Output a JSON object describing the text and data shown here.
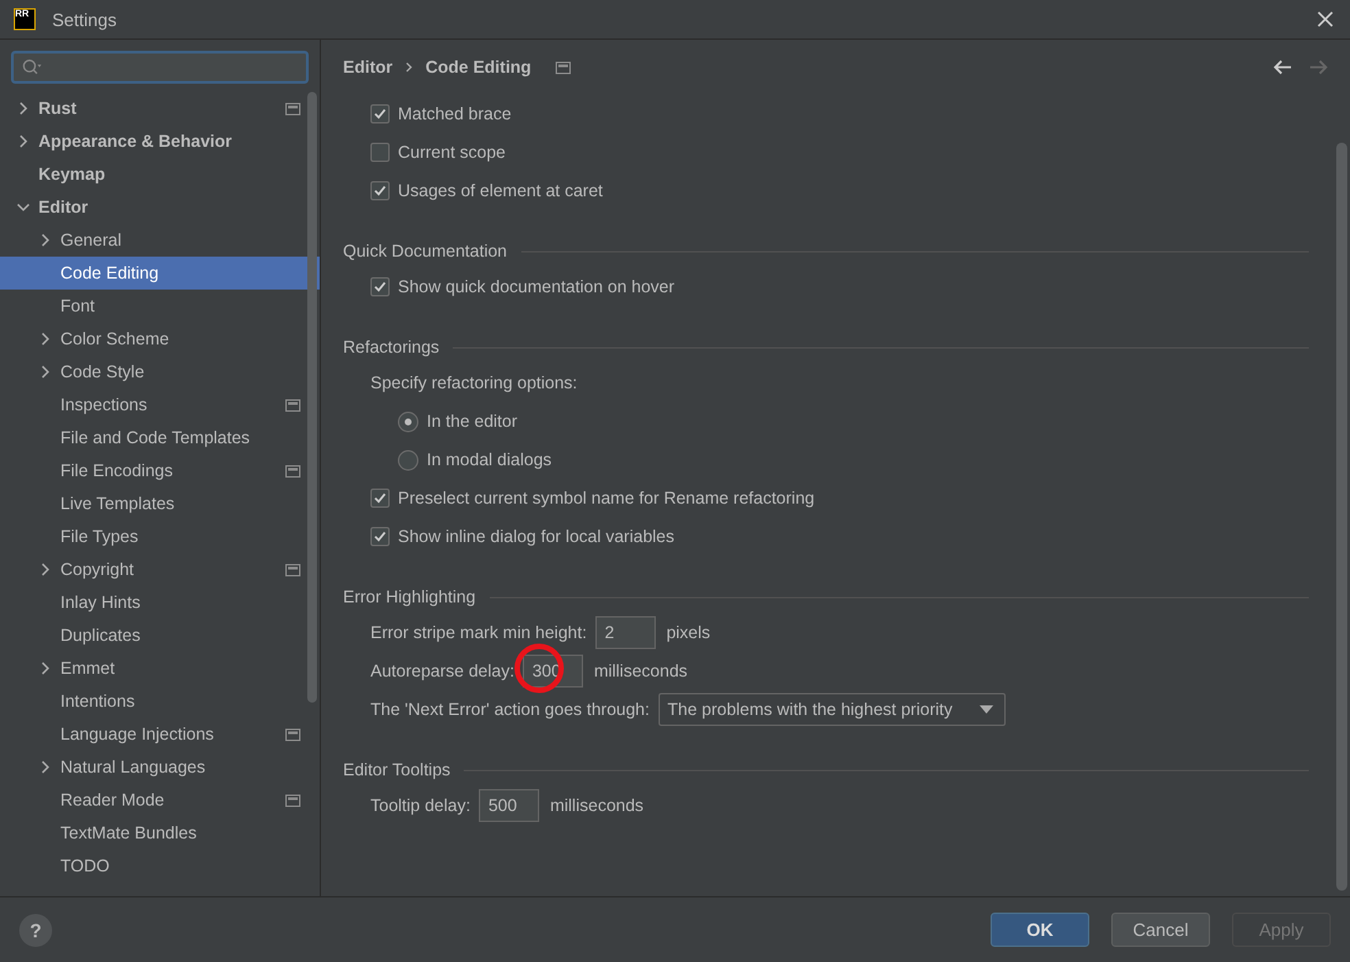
{
  "window": {
    "title": "Settings",
    "logo": "RR"
  },
  "sidebar": {
    "items": [
      {
        "label": "Rust",
        "expanded": false,
        "selected": false,
        "project_level": true
      },
      {
        "label": "Appearance & Behavior",
        "expanded": false,
        "selected": false,
        "project_level": false
      },
      {
        "label": "Keymap",
        "selected": false,
        "project_level": false
      },
      {
        "label": "Editor",
        "expanded": true,
        "selected": false,
        "project_level": false,
        "children": [
          {
            "label": "General",
            "expanded": false,
            "selected": false,
            "project_level": false
          },
          {
            "label": "Code Editing",
            "selected": true,
            "project_level": false
          },
          {
            "label": "Font",
            "selected": false,
            "project_level": false
          },
          {
            "label": "Color Scheme",
            "expanded": false,
            "selected": false,
            "project_level": false
          },
          {
            "label": "Code Style",
            "expanded": false,
            "selected": false,
            "project_level": false
          },
          {
            "label": "Inspections",
            "selected": false,
            "project_level": true
          },
          {
            "label": "File and Code Templates",
            "selected": false,
            "project_level": false
          },
          {
            "label": "File Encodings",
            "selected": false,
            "project_level": true
          },
          {
            "label": "Live Templates",
            "selected": false,
            "project_level": false
          },
          {
            "label": "File Types",
            "selected": false,
            "project_level": false
          },
          {
            "label": "Copyright",
            "expanded": false,
            "selected": false,
            "project_level": true
          },
          {
            "label": "Inlay Hints",
            "selected": false,
            "project_level": false
          },
          {
            "label": "Duplicates",
            "selected": false,
            "project_level": false
          },
          {
            "label": "Emmet",
            "expanded": false,
            "selected": false,
            "project_level": false
          },
          {
            "label": "Intentions",
            "selected": false,
            "project_level": false
          },
          {
            "label": "Language Injections",
            "selected": false,
            "project_level": true
          },
          {
            "label": "Natural Languages",
            "expanded": false,
            "selected": false,
            "project_level": false
          },
          {
            "label": "Reader Mode",
            "selected": false,
            "project_level": true
          },
          {
            "label": "TextMate Bundles",
            "selected": false,
            "project_level": false
          },
          {
            "label": "TODO",
            "selected": false,
            "project_level": false
          }
        ]
      }
    ]
  },
  "breadcrumb": {
    "items": [
      "Editor",
      "Code Editing"
    ],
    "project_level": true
  },
  "sections": [
    {
      "rows": [
        {
          "kind": "checkbox",
          "label": "Matched brace",
          "checked": true
        },
        {
          "kind": "checkbox",
          "label": "Current scope",
          "checked": false
        },
        {
          "kind": "checkbox",
          "label": "Usages of element at caret",
          "checked": true
        }
      ]
    },
    {
      "title": "Quick Documentation",
      "rows": [
        {
          "kind": "checkbox",
          "label": "Show quick documentation on hover",
          "checked": true
        }
      ]
    },
    {
      "title": "Refactorings",
      "rows": [
        {
          "kind": "label",
          "label": "Specify refactoring options:"
        },
        {
          "kind": "radio",
          "label": "In the editor",
          "selected": true
        },
        {
          "kind": "radio",
          "label": "In modal dialogs",
          "selected": false
        },
        {
          "kind": "checkbox",
          "label": "Preselect current symbol name for Rename refactoring",
          "checked": true
        },
        {
          "kind": "checkbox",
          "label": "Show inline dialog for local variables",
          "checked": true
        }
      ]
    },
    {
      "title": "Error Highlighting",
      "rows": [
        {
          "kind": "number",
          "label": "Error stripe mark min height:",
          "value": "2",
          "unit": "pixels",
          "highlighted": false
        },
        {
          "kind": "number",
          "label": "Autoreparse delay:",
          "value": "300",
          "unit": "milliseconds",
          "highlighted": true
        },
        {
          "kind": "dropdown",
          "label": "The 'Next Error' action goes through:",
          "value": "The problems with the highest priority"
        }
      ]
    },
    {
      "title": "Editor Tooltips",
      "rows": [
        {
          "kind": "number",
          "label": "Tooltip delay:",
          "value": "500",
          "unit": "milliseconds",
          "highlighted": false
        }
      ]
    }
  ],
  "help_button": {
    "label": "?"
  },
  "buttons": [
    {
      "label": "OK",
      "kind": "primary",
      "disabled": false
    },
    {
      "label": "Cancel",
      "kind": "normal",
      "disabled": false
    },
    {
      "label": "Apply",
      "kind": "normal",
      "disabled": true
    }
  ]
}
